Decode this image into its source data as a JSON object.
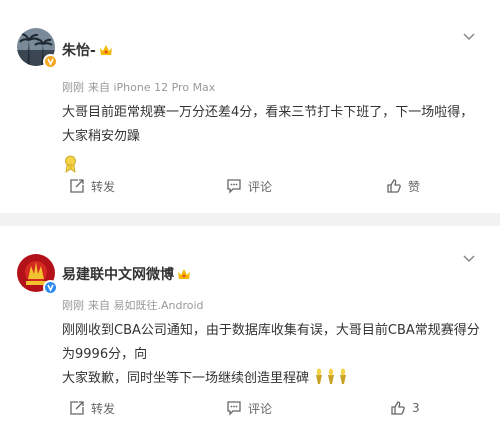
{
  "posts": [
    {
      "username": "朱怡-",
      "time": "刚刚",
      "source": "来自 iPhone 12 Pro Max",
      "text": "大哥目前距常规赛一万分还差4分，看来三节打卡下班了，下一场啦得，大家稍安勿躁",
      "actions": {
        "repost": "转发",
        "comment": "评论",
        "like": "赞"
      }
    },
    {
      "username": "易建联中文网微博",
      "time": "刚刚",
      "source": "来自 易如既往.Android",
      "text_line1": "刚刚收到CBA公司通知，由于数据库收集有误，大哥目前CBA常规赛得分为9996分，向",
      "text_line2": "大家致歉，同时坐等下一场继续创造里程碑",
      "actions": {
        "repost": "转发",
        "comment": "评论",
        "like": "3"
      }
    }
  ],
  "colors": {
    "verified_gold": "#f5a623",
    "verified_blue": "#2f8bf2",
    "crown": "#f5b800",
    "text_gray": "#999999"
  }
}
